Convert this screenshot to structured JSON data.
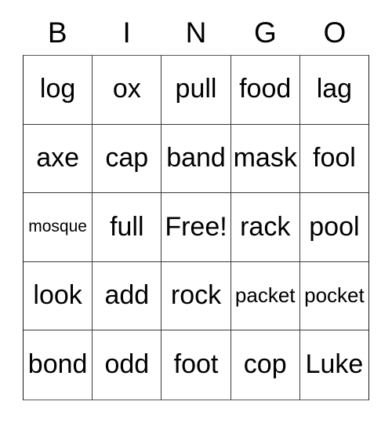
{
  "card": {
    "title": "BINGO",
    "header": [
      "B",
      "I",
      "N",
      "G",
      "O"
    ],
    "free_space_label": "Free!",
    "rows": [
      [
        {
          "label": "log",
          "size": "normal"
        },
        {
          "label": "ox",
          "size": "normal"
        },
        {
          "label": "pull",
          "size": "normal"
        },
        {
          "label": "food",
          "size": "normal"
        },
        {
          "label": "lag",
          "size": "normal"
        }
      ],
      [
        {
          "label": "axe",
          "size": "normal"
        },
        {
          "label": "cap",
          "size": "normal"
        },
        {
          "label": "band",
          "size": "normal"
        },
        {
          "label": "mask",
          "size": "normal"
        },
        {
          "label": "fool",
          "size": "normal"
        }
      ],
      [
        {
          "label": "mosque",
          "size": "small"
        },
        {
          "label": "full",
          "size": "normal"
        },
        {
          "label": "Free!",
          "size": "normal"
        },
        {
          "label": "rack",
          "size": "normal"
        },
        {
          "label": "pool",
          "size": "normal"
        }
      ],
      [
        {
          "label": "look",
          "size": "normal"
        },
        {
          "label": "add",
          "size": "normal"
        },
        {
          "label": "rock",
          "size": "normal"
        },
        {
          "label": "packet",
          "size": "medium"
        },
        {
          "label": "pocket",
          "size": "medium"
        }
      ],
      [
        {
          "label": "bond",
          "size": "normal"
        },
        {
          "label": "odd",
          "size": "normal"
        },
        {
          "label": "foot",
          "size": "normal"
        },
        {
          "label": "cop",
          "size": "normal"
        },
        {
          "label": "Luke",
          "size": "normal"
        }
      ]
    ]
  },
  "colors": {
    "background": "#ffffff",
    "text": "#000000",
    "grid_border": "#3a3a3a",
    "outer_border": "#1a1a1a"
  }
}
